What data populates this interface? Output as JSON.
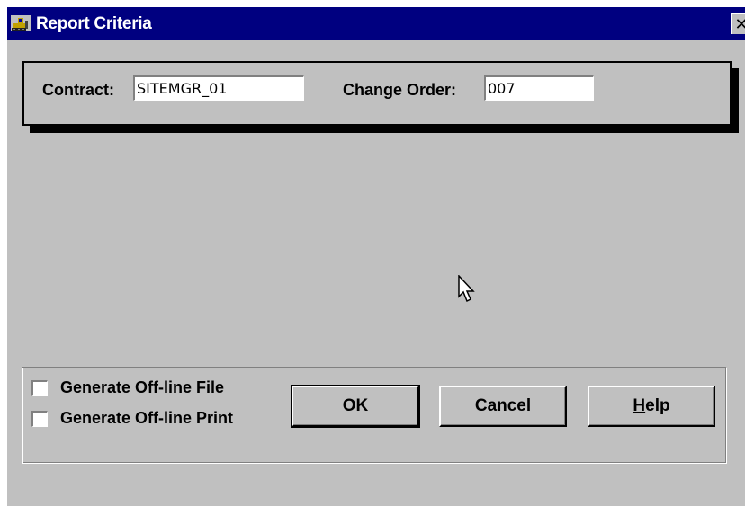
{
  "window": {
    "title": "Report Criteria",
    "close_glyph": "✕",
    "app_icon": "bulldozer-icon"
  },
  "criteria": {
    "contract_label": "Contract:",
    "contract_value": "SITEMGR_01",
    "change_order_label": "Change Order:",
    "change_order_value": "007"
  },
  "options": {
    "offline_file_label": "Generate Off-line File",
    "offline_file_checked": false,
    "offline_print_label": "Generate Off-line Print",
    "offline_print_checked": false
  },
  "buttons": {
    "ok": "OK",
    "cancel": "Cancel",
    "help_mnemonic": "H",
    "help_rest": "elp"
  },
  "colors": {
    "titlebar": "#000080",
    "face": "#c0c0c0",
    "field_bg": "#ffffff"
  }
}
